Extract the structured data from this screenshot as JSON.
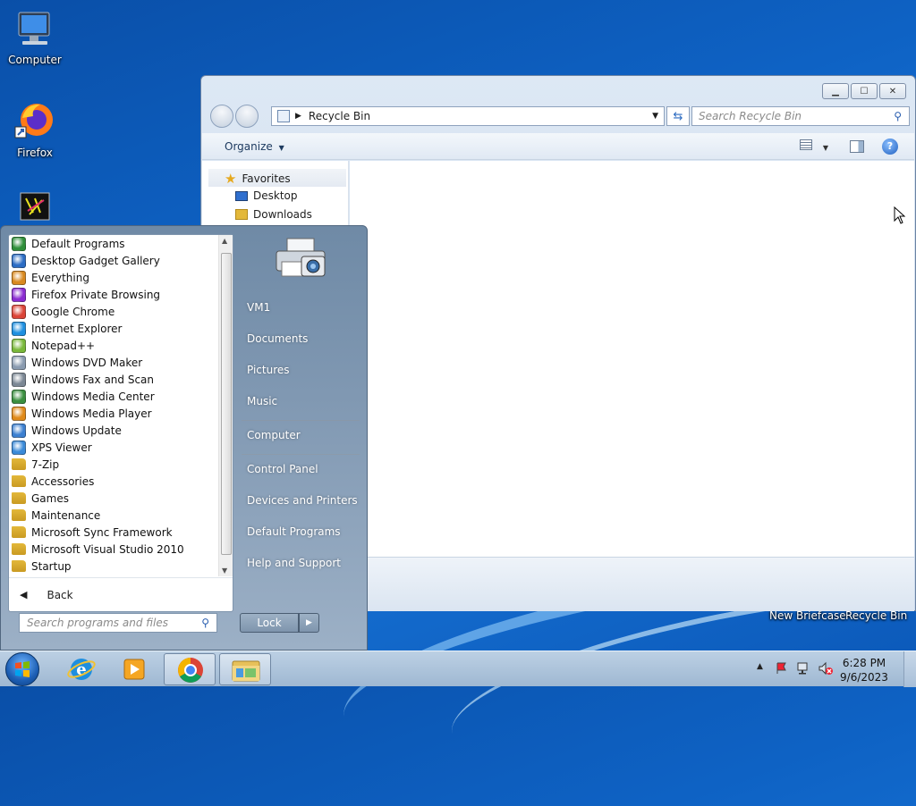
{
  "desktop": {
    "icons": [
      {
        "label": "Computer",
        "icon": "computer-icon"
      },
      {
        "label": "Firefox",
        "icon": "firefox-icon"
      },
      {
        "label": "",
        "icon": "app-icon"
      }
    ],
    "bottom_labels": [
      "New Briefcase",
      "Recycle Bin"
    ]
  },
  "explorer": {
    "address": "Recycle Bin",
    "search_placeholder": "Search Recycle Bin",
    "organize_label": "Organize",
    "nav": {
      "favorites": "Favorites",
      "items": [
        "Desktop",
        "Downloads"
      ]
    }
  },
  "start_menu": {
    "programs": [
      {
        "label": "Default Programs",
        "icon": "default-programs-icon",
        "color": "#2f8f3a"
      },
      {
        "label": "Desktop Gadget Gallery",
        "icon": "gadget-icon",
        "color": "#2b6cc4"
      },
      {
        "label": "Everything",
        "icon": "magnifier-icon",
        "color": "#d9891f"
      },
      {
        "label": "Firefox Private Browsing",
        "icon": "firefox-private-icon",
        "color": "#8a2bd0"
      },
      {
        "label": "Google Chrome",
        "icon": "chrome-icon",
        "color": "#db4437"
      },
      {
        "label": "Internet Explorer",
        "icon": "ie-icon",
        "color": "#1e8fe0"
      },
      {
        "label": "Notepad++",
        "icon": "notepadpp-icon",
        "color": "#79b83a"
      },
      {
        "label": "Windows DVD Maker",
        "icon": "dvd-icon",
        "color": "#8a9bb0"
      },
      {
        "label": "Windows Fax and Scan",
        "icon": "fax-icon",
        "color": "#7b8794"
      },
      {
        "label": "Windows Media Center",
        "icon": "media-center-icon",
        "color": "#3a8f3f"
      },
      {
        "label": "Windows Media Player",
        "icon": "media-player-icon",
        "color": "#e08a1a"
      },
      {
        "label": "Windows Update",
        "icon": "windows-update-icon",
        "color": "#3b7fd0"
      },
      {
        "label": "XPS Viewer",
        "icon": "xps-icon",
        "color": "#3a8ad8"
      },
      {
        "label": "7-Zip",
        "icon": "folder-icon",
        "color": "#e3b83a"
      },
      {
        "label": "Accessories",
        "icon": "folder-icon",
        "color": "#e3b83a"
      },
      {
        "label": "Games",
        "icon": "folder-icon",
        "color": "#e3b83a"
      },
      {
        "label": "Maintenance",
        "icon": "folder-icon",
        "color": "#e3b83a"
      },
      {
        "label": "Microsoft Sync Framework",
        "icon": "folder-icon",
        "color": "#e3b83a"
      },
      {
        "label": "Microsoft Visual Studio 2010",
        "icon": "folder-icon",
        "color": "#e3b83a"
      },
      {
        "label": "Startup",
        "icon": "folder-icon",
        "color": "#e3b83a"
      }
    ],
    "back_label": "Back",
    "search_placeholder": "Search programs and files",
    "right_items": [
      "VM1",
      "Documents",
      "Pictures",
      "Music",
      "Computer",
      "Control Panel",
      "Devices and Printers",
      "Default Programs",
      "Help and Support"
    ],
    "lock_label": "Lock"
  },
  "taskbar": {
    "time": "6:28 PM",
    "date": "9/6/2023"
  }
}
